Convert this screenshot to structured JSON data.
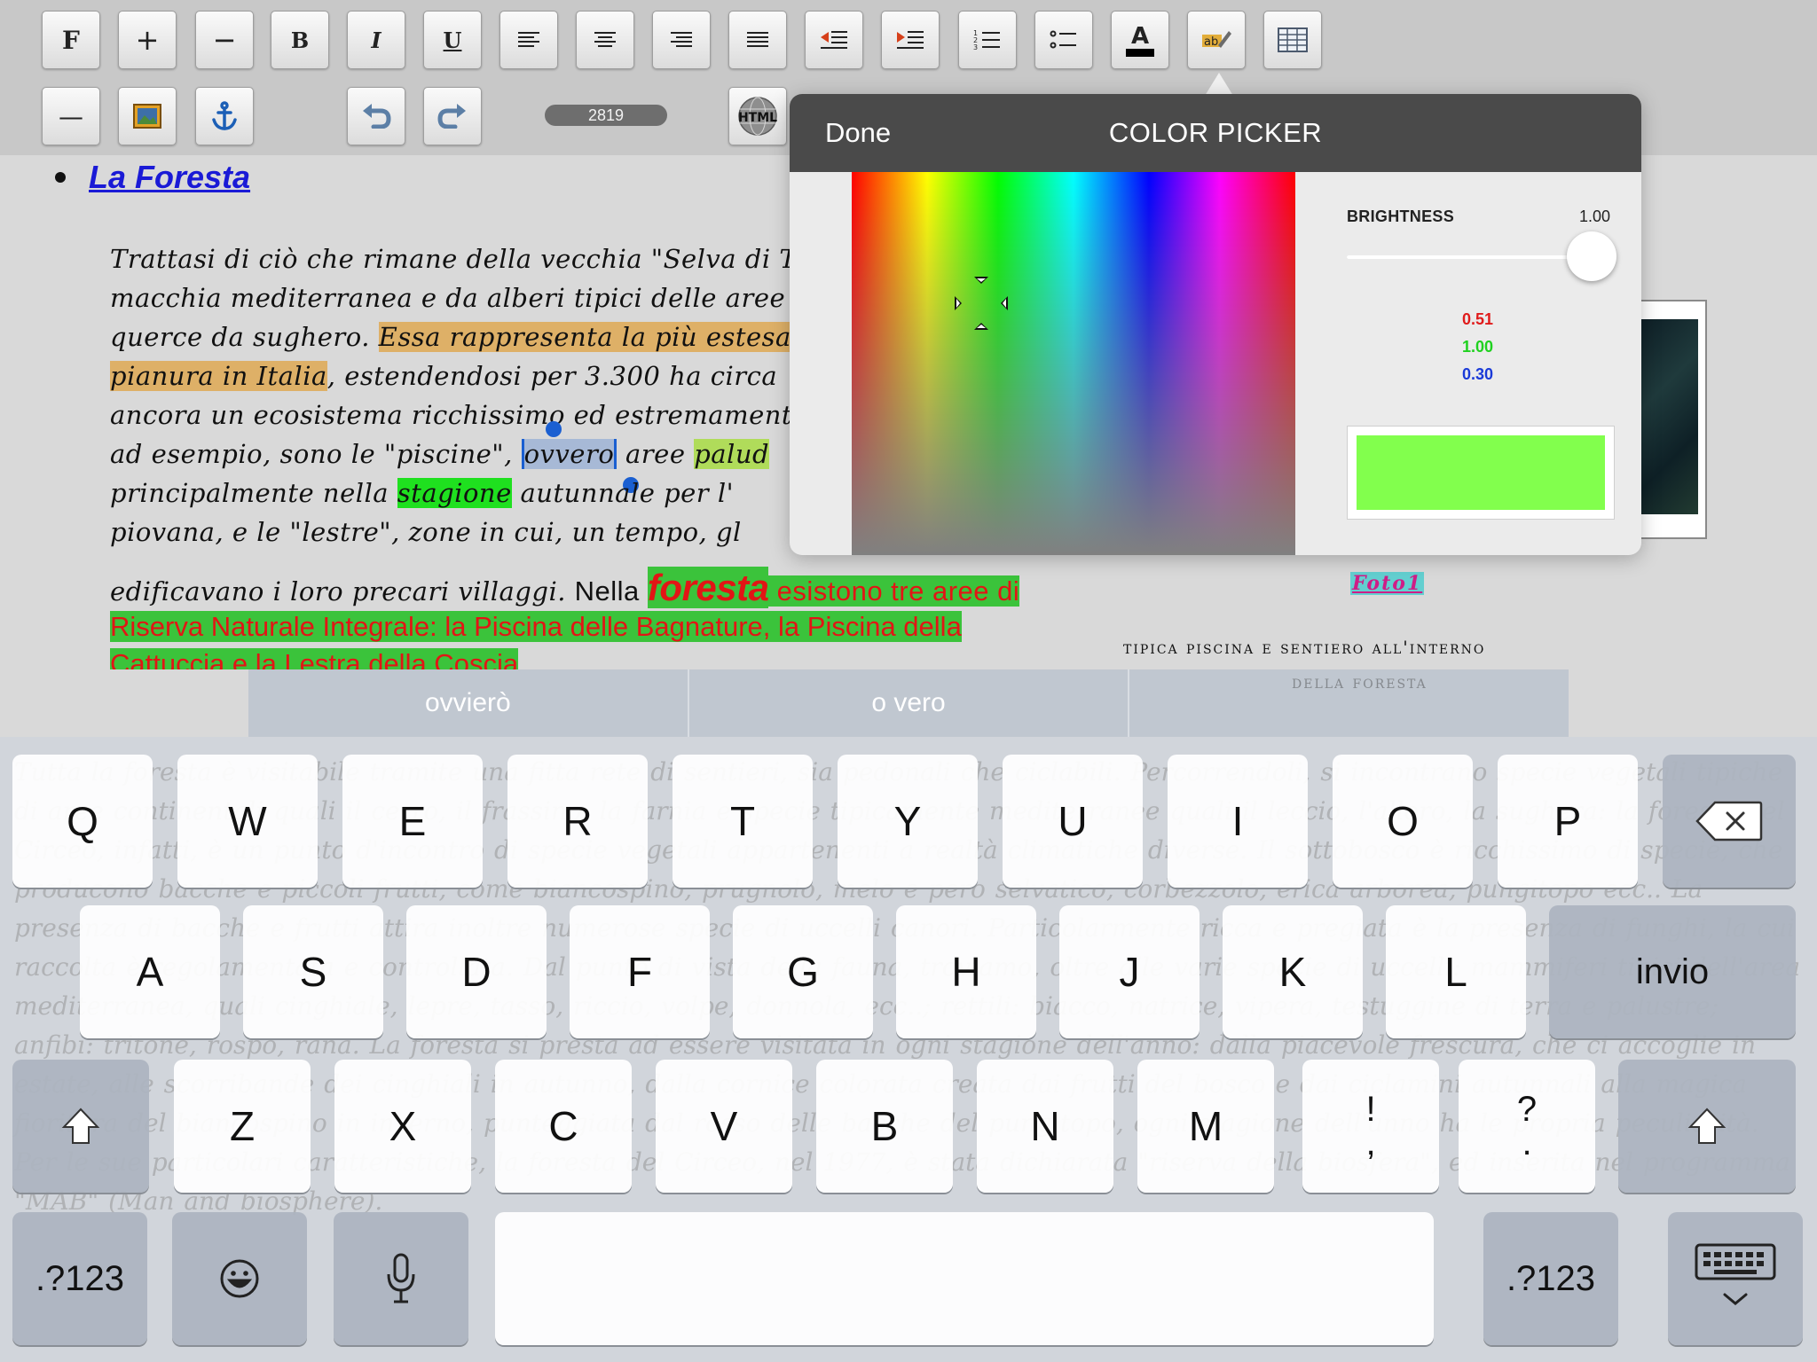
{
  "toolbar": {
    "font_label": "F",
    "plus_label": "+",
    "minus_label": "−",
    "bold_label": "B",
    "italic_label": "I",
    "underline_label": "U",
    "rule_label": "—",
    "word_count": "2819"
  },
  "document": {
    "heading": "La Foresta",
    "lines": {
      "l1": "Trattasi di ciò che rimane della vecchia \"Selva di Te",
      "l2": "macchia mediterranea e da alberi tipici delle aree ma",
      "l3a": "querce da sughero. ",
      "l3b": "Essa rappresenta la più estesa",
      "l4a": "pianura in Italia",
      "l4b": ", estendendosi per 3.300 ha circa",
      "l5": "ancora un ecosistema ricchissimo ed estremamente",
      "l6a": "ad esempio, sono le \"piscine\", ",
      "l6b": "ovvero",
      "l6c": " aree ",
      "l6d": "palud",
      "l7a": "principalmente nella ",
      "l7b": "stagione",
      "l7c": " autunnale per l'",
      "l8": "piovana, e le \"lestre\", zone in cui, un tempo, gl",
      "l9a": "edificavano i loro precari villaggi. ",
      "l9b": "Nella ",
      "l9c": "foresta",
      "l9d": " esistono tre aree di",
      "l10": "Riserva Naturale Integrale: la Piscina delle Bagnature, la Piscina della",
      "l11": "Cattuccia e la Lestra della Coscia"
    },
    "photo_link": "Foto1",
    "photo_caption_1": "tipica piscina e sentiero all'interno",
    "photo_caption_2": "della foresta"
  },
  "color_picker": {
    "done_label": "Done",
    "title": "COLOR PICKER",
    "brightness_label": "BRIGHTNESS",
    "brightness_value": "1.00",
    "brightness": 1.0,
    "r": "0.51",
    "g": "1.00",
    "b": "0.30",
    "swatch_color": "#82ff4d"
  },
  "suggestions": [
    "ovvierò",
    "o vero",
    ""
  ],
  "ghost_text": "Tutta la foresta è visitabile tramite una fitta rete di sentieri, sia pedonali che ciclabili. Percorrendoli, si incontrano specie vegetali tipiche di aree continentali quali il cerro, il frassino, la farnia e specie tipicamente mediterranee quali il leccio, l'alloro, la sughera: la foresta del Circeo, infatti, è un punto d'incontro di specie vegetali appartenenti a realtà climatiche diverse. Il sottobosco è ricchissimo di specie, che producono bacche e piccoli frutti, come biancospino, prugnolo, melo e pero selvatico, corbezzolo, erica arborea, pungitopo ecc.. La presenza di bacche e frutti attira inoltre numerose specie di uccelli canori. Particolarmente ricca e pregiata è la presenza di funghi, la cui raccolta è regolamentata e controllata. Dal punto di vista della fauna, troviamo, oltre alle varie specie di uccelli: mammiferi tipici dell'area mediterranea, quali cinghiale, lepre, tasso, riccio, volpe, donnola, ecc..; rettili: biacco, natrice, vipera, testuggine di terra e palustre; anfibi: tritone, rospo, rana. La foresta si presta ad essere visitata in ogni stagione dell'anno: dalla piacevole frescura, che ci accoglie in estate, alle scorribande dei cinghiali in autunno, dalla cornice colorata creata dai frutti del bosco e dai ciclamini autunnali alla magica fioritura del biancospino in inverno, punteggiata dal rosso delle bacche del pungitopo, ogni stagione dell'anno ha le propria peculiarità. Per le sue particolari caratteristiche, la foresta del Circeo, nel 1977, è stata dichiarata \"riserva della biosfera\", ed inserita nel programma \"MAB\" (Man and biosphere).",
  "keyboard": {
    "row1": [
      "Q",
      "W",
      "E",
      "R",
      "T",
      "Y",
      "U",
      "I",
      "O",
      "P"
    ],
    "row2": [
      "A",
      "S",
      "D",
      "F",
      "G",
      "H",
      "J",
      "K",
      "L"
    ],
    "row3": [
      "Z",
      "X",
      "C",
      "V",
      "B",
      "N",
      "M"
    ],
    "return_label": "invio",
    "numbers_label": ".?123",
    "punct1_top": "!",
    "punct1_bottom": ",",
    "punct2_top": "?",
    "punct2_bottom": "."
  }
}
